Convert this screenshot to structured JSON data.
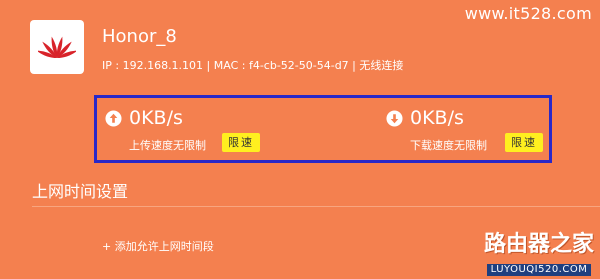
{
  "watermark": {
    "site": "www.it528.com"
  },
  "device": {
    "name": "Honor_8",
    "info": "IP : 192.168.1.101 | MAC : f4-cb-52-50-54-d7 | 无线连接"
  },
  "speed": {
    "upload": {
      "value": "0KB/s",
      "caption": "上传速度无限制",
      "button": "限速"
    },
    "download": {
      "value": "0KB/s",
      "caption": "下载速度无限制",
      "button": "限速"
    }
  },
  "section": {
    "title": "上网时间设置",
    "add_link": "+ 添加允许上网时间段"
  },
  "brand": {
    "main": "路由器之家",
    "sub": "LUYOUQI520.COM"
  },
  "colors": {
    "background": "#f4804f",
    "highlight_border": "#2828c8",
    "limit_button": "#ffef1f",
    "logo_red": "#d8232a"
  }
}
